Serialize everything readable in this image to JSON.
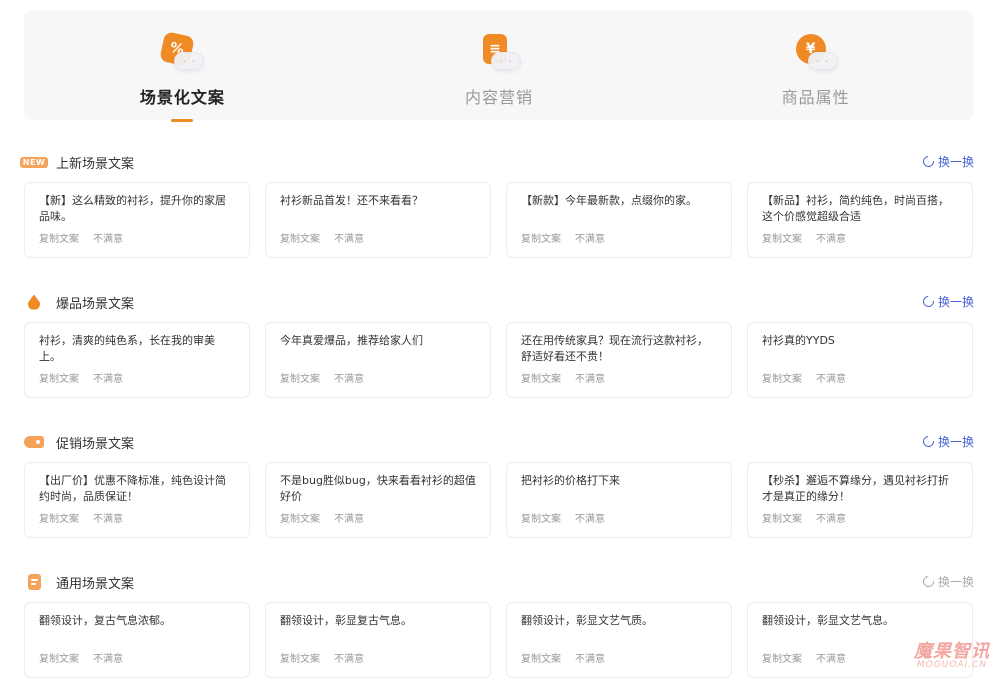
{
  "tabs": [
    {
      "label": "场景化文案",
      "icon": "percent-badge-icon",
      "glyph": "%",
      "active": true
    },
    {
      "label": "内容营销",
      "icon": "document-icon",
      "glyph": "≡",
      "active": false
    },
    {
      "label": "商品属性",
      "icon": "yen-coin-icon",
      "glyph": "¥",
      "active": false
    }
  ],
  "sections": [
    {
      "title": "上新场景文案",
      "icon": "new-badge-icon",
      "badge_text": "NEW",
      "refresh_label": "换一换",
      "refresh_enabled": true,
      "cards": [
        {
          "text": "【新】这么精致的衬衫，提升你的家居品味。",
          "copy": "复制文案",
          "dislike": "不满意"
        },
        {
          "text": "衬衫新品首发！还不来看看？",
          "copy": "复制文案",
          "dislike": "不满意"
        },
        {
          "text": "【新款】今年最新款，点缀你的家。",
          "copy": "复制文案",
          "dislike": "不满意"
        },
        {
          "text": "【新品】衬衫，简约纯色，时尚百搭，这个价感觉超级合适",
          "copy": "复制文案",
          "dislike": "不满意"
        }
      ]
    },
    {
      "title": "爆品场景文案",
      "icon": "flame-icon",
      "refresh_label": "换一换",
      "refresh_enabled": true,
      "cards": [
        {
          "text": "衬衫，清爽的纯色系，长在我的审美上。",
          "copy": "复制文案",
          "dislike": "不满意"
        },
        {
          "text": "今年真爱爆品，推荐给家人们",
          "copy": "复制文案",
          "dislike": "不满意"
        },
        {
          "text": "还在用传统家具？现在流行这款衬衫，舒适好看还不贵！",
          "copy": "复制文案",
          "dislike": "不满意"
        },
        {
          "text": "衬衫真的YYDS",
          "copy": "复制文案",
          "dislike": "不满意"
        }
      ]
    },
    {
      "title": "促销场景文案",
      "icon": "price-tag-icon",
      "refresh_label": "换一换",
      "refresh_enabled": true,
      "cards": [
        {
          "text": "【出厂价】优惠不降标准，纯色设计简约时尚，品质保证！",
          "copy": "复制文案",
          "dislike": "不满意"
        },
        {
          "text": "不是bug胜似bug，快来看看衬衫的超值好价",
          "copy": "复制文案",
          "dislike": "不满意"
        },
        {
          "text": "把衬衫的价格打下来",
          "copy": "复制文案",
          "dislike": "不满意"
        },
        {
          "text": "【秒杀】邂逅不算缘分，遇见衬衫打折才是真正的缘分！",
          "copy": "复制文案",
          "dislike": "不满意"
        }
      ]
    },
    {
      "title": "通用场景文案",
      "icon": "document-icon",
      "refresh_label": "换一换",
      "refresh_enabled": false,
      "cards": [
        {
          "text": "翻领设计，复古气息浓郁。",
          "copy": "复制文案",
          "dislike": "不满意"
        },
        {
          "text": "翻领设计，彰显复古气息。",
          "copy": "复制文案",
          "dislike": "不满意"
        },
        {
          "text": "翻领设计，彰显文艺气质。",
          "copy": "复制文案",
          "dislike": "不满意"
        },
        {
          "text": "翻领设计，彰显文艺气息。",
          "copy": "复制文案",
          "dislike": "不满意"
        }
      ]
    }
  ],
  "watermark": {
    "line1": "魔果智讯",
    "line2": "MOGUOAI.CN"
  },
  "colors": {
    "accent": "#f08a24",
    "link": "#4a62d8"
  }
}
